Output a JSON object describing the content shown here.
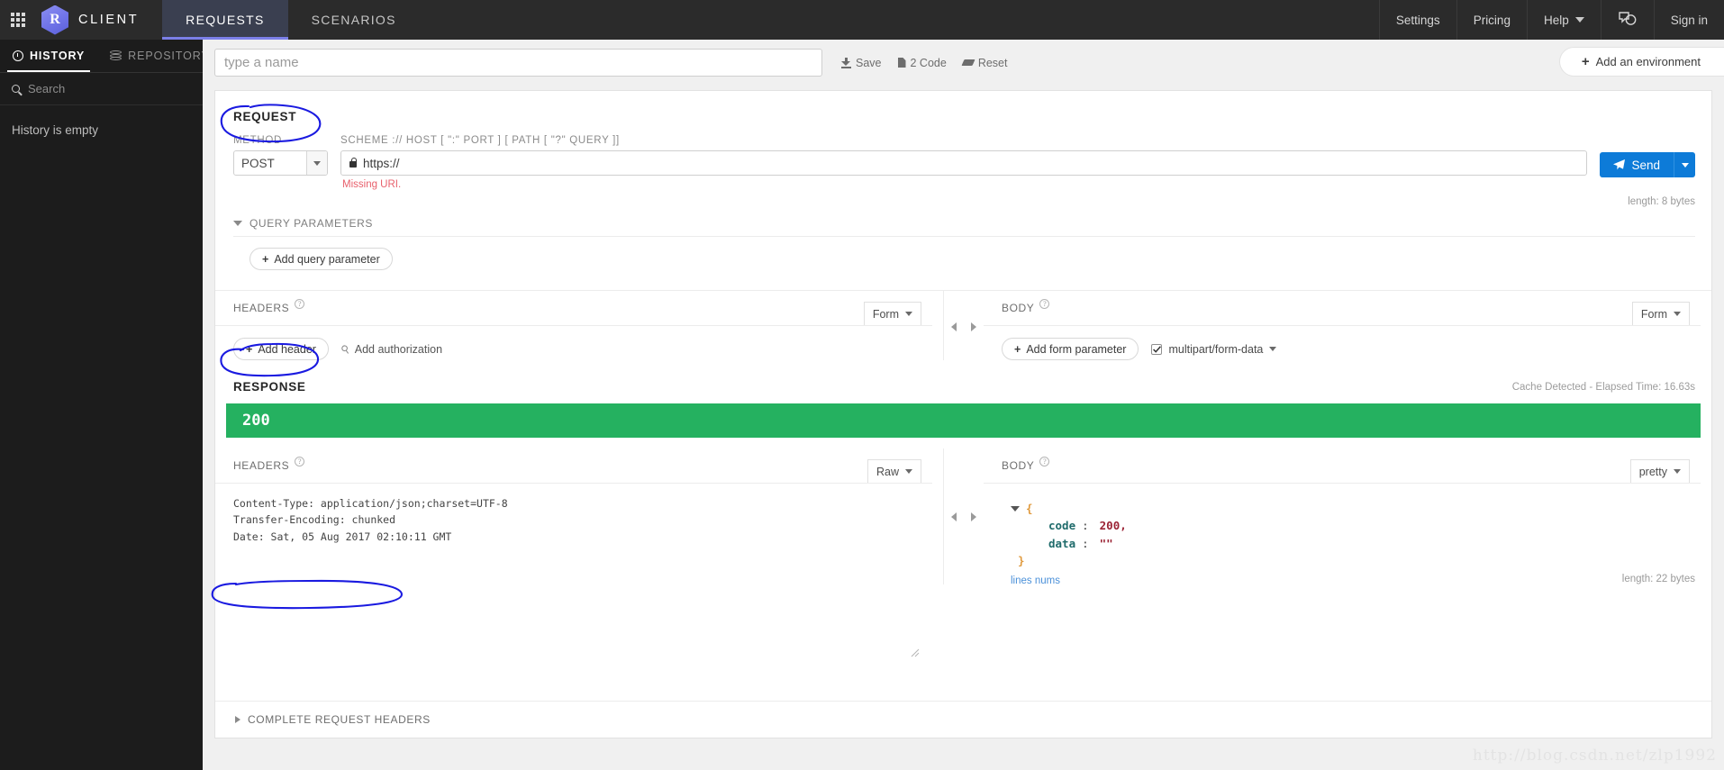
{
  "topnav": {
    "grid_icon": "apps-grid-icon",
    "logo_letter": "R",
    "brand": "CLIENT",
    "tabs": [
      {
        "label": "REQUESTS",
        "active": true
      },
      {
        "label": "SCENARIOS",
        "active": false
      }
    ],
    "right_items": [
      {
        "label": "Settings"
      },
      {
        "label": "Pricing"
      },
      {
        "label": "Help",
        "caret": true
      },
      {
        "label": "Sign in"
      }
    ],
    "chat_icon": "chat-bubbles-icon"
  },
  "sidebar": {
    "tabs": [
      {
        "label": "HISTORY",
        "icon": "clock-icon",
        "active": true
      },
      {
        "label": "REPOSITORY",
        "icon": "database-icon",
        "active": false
      }
    ],
    "search_placeholder": "Search",
    "search_icon": "search-icon",
    "empty_text": "History is empty"
  },
  "namebar": {
    "placeholder": "type a name",
    "value": "",
    "actions": [
      {
        "label": "Save",
        "icon": "save-icon"
      },
      {
        "label": "2 Code",
        "icon": "document-icon"
      },
      {
        "label": "Reset",
        "icon": "eraser-icon"
      }
    ],
    "add_environment": "Add an environment",
    "plus": "+"
  },
  "request": {
    "section_title": "REQUEST",
    "method_label": "METHOD",
    "method_value": "POST",
    "uri_label": "SCHEME :// HOST [ \":\" PORT ] [ PATH [ \"?\" QUERY ]]",
    "uri_value": "https://",
    "lock_icon": "lock-icon",
    "error": "Missing URI.",
    "send_label": "Send",
    "send_icon": "paper-plane-icon",
    "length": "length: 8 bytes",
    "query_parameters_label": "QUERY PARAMETERS",
    "add_query_parameter": "Add query parameter",
    "headers": {
      "title": "HEADERS",
      "help_icon": "help-circle-icon",
      "view_mode": "Form",
      "add_header": "Add header",
      "add_authorization": "Add authorization",
      "auth_icon": "key-icon"
    },
    "body": {
      "title": "BODY",
      "help_icon": "help-circle-icon",
      "view_mode": "Form",
      "add_form_parameter": "Add form parameter",
      "content_type": "multipart/form-data",
      "content_type_checked": true
    }
  },
  "response": {
    "section_title": "RESPONSE",
    "cache_text": "Cache Detected - Elapsed Time: 16.63s",
    "status_code": "200",
    "status_color": "#25b160",
    "headers": {
      "title": "HEADERS",
      "help_icon": "help-circle-icon",
      "view_mode": "Raw",
      "lines": [
        "Content-Type: application/json;charset=UTF-8",
        "Transfer-Encoding: chunked",
        "Date: Sat, 05 Aug 2017 02:10:11 GMT"
      ]
    },
    "body": {
      "title": "BODY",
      "help_icon": "help-circle-icon",
      "view_mode": "pretty",
      "open_brace": "{",
      "close_brace": "}",
      "fields": [
        {
          "key": "code",
          "colon": ":",
          "value": "200,",
          "type": "number"
        },
        {
          "key": "data",
          "colon": ":",
          "value": "\"\"",
          "type": "string"
        }
      ],
      "lines_nums": "lines nums",
      "length": "length: 22 bytes"
    },
    "complete_request_headers": "COMPLETE REQUEST HEADERS"
  },
  "annotations": {
    "color": "#1a1ae0",
    "items": [
      "REQUEST",
      "RESPONSE",
      "COMPLETE REQUEST HEADERS"
    ]
  },
  "watermark": "http://blog.csdn.net/zlp1992"
}
